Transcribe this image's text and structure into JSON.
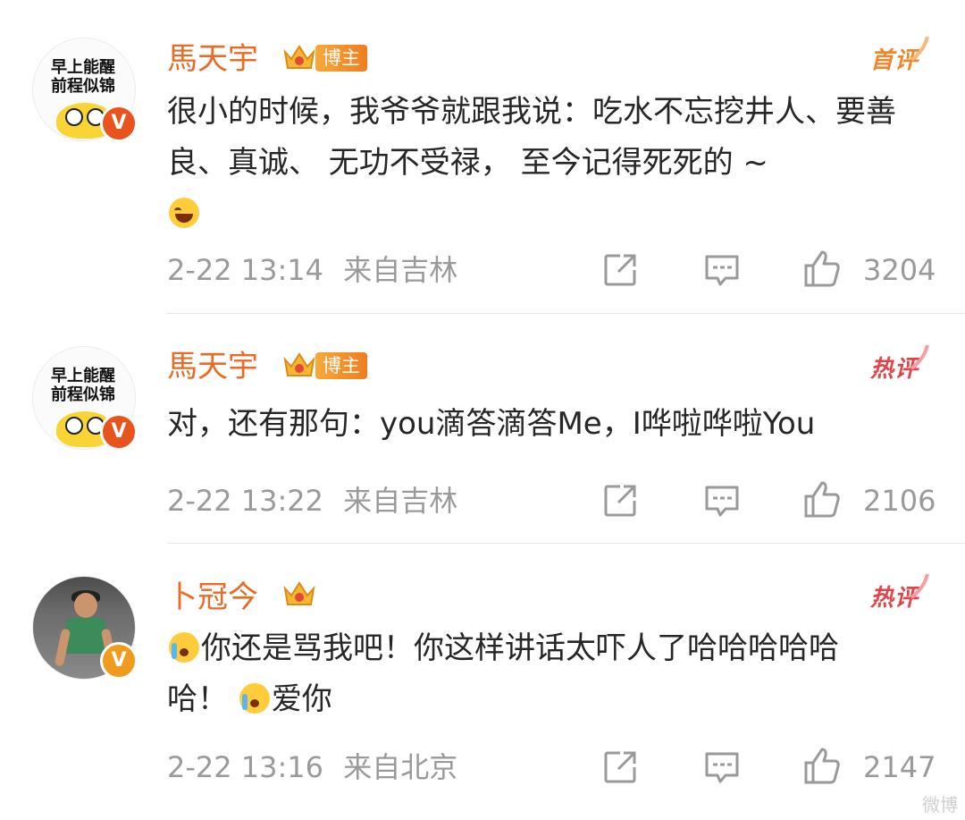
{
  "comments": [
    {
      "username": "馬天宇",
      "avatar_text_1": "早上能醒",
      "avatar_text_2": "前程似锦",
      "verified_badge": "V",
      "tag": "博主",
      "rank_label": "首评",
      "text_before_emoji": "很小的时候，我爷爷就跟我说：吃水不忘挖井人、要善良、真诚、 无功不受禄，  至今记得死死的 ~",
      "emoji": "laugh-cry-emoji",
      "time": "2-22 13:14",
      "location": "来自吉林",
      "likes": "3204"
    },
    {
      "username": "馬天宇",
      "avatar_text_1": "早上能醒",
      "avatar_text_2": "前程似锦",
      "verified_badge": "V",
      "tag": "博主",
      "rank_label": "热评",
      "text": "对，还有那句：you滴答滴答Me，I哗啦哗啦You",
      "time": "2-22 13:22",
      "location": "来自吉林",
      "likes": "2106"
    },
    {
      "username": "卜冠今",
      "verified_badge": "V",
      "rank_label": "热评",
      "text_part1": "你还是骂我吧！你这样讲话太吓人了哈哈哈哈哈",
      "text_part2": "哈！",
      "text_part3": "爱你",
      "emoji": "crying-emoji",
      "time": "2-22 13:16",
      "location": "来自北京",
      "likes": "2147"
    }
  ],
  "watermark": "微博",
  "colors": {
    "username": "#ec6a23",
    "meta": "#9a9a9a",
    "first_review": "#f0862a",
    "hot_review": "#e0454b"
  },
  "icons": {
    "share": "share-icon",
    "comment": "comment-icon",
    "like": "thumbs-up-icon"
  }
}
